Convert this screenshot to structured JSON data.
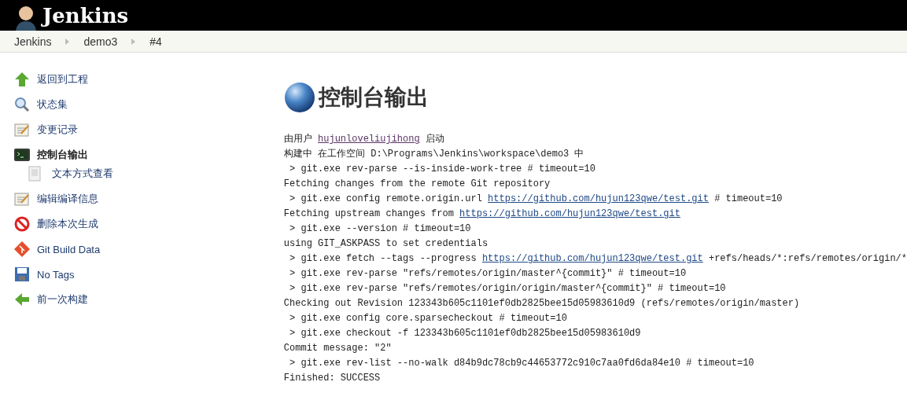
{
  "header": {
    "title": "Jenkins"
  },
  "breadcrumbs": [
    "Jenkins",
    "demo3",
    "#4"
  ],
  "sidebar": {
    "items": [
      {
        "label": "返回到工程",
        "selected": false
      },
      {
        "label": "状态集",
        "selected": false
      },
      {
        "label": "变更记录",
        "selected": false
      },
      {
        "label": "控制台输出",
        "selected": true,
        "children": [
          {
            "label": "文本方式查看",
            "selected": false
          }
        ]
      },
      {
        "label": "编辑编译信息",
        "selected": false
      },
      {
        "label": "删除本次生成",
        "selected": false
      },
      {
        "label": "Git Build Data",
        "selected": false
      },
      {
        "label": "No Tags",
        "selected": false
      },
      {
        "label": "前一次构建",
        "selected": false
      }
    ]
  },
  "page_title": "控制台输出",
  "console": [
    [
      {
        "text": "由用户 "
      },
      {
        "text": "hujunloveliujihong",
        "link": true,
        "visited": true
      },
      {
        "text": " 启动"
      }
    ],
    [
      {
        "text": "构建中 在工作空间 D:\\Programs\\Jenkins\\workspace\\demo3 中"
      }
    ],
    [
      {
        "text": " > git.exe rev-parse --is-inside-work-tree # timeout=10"
      }
    ],
    [
      {
        "text": "Fetching changes from the remote Git repository"
      }
    ],
    [
      {
        "text": " > git.exe config remote.origin.url "
      },
      {
        "text": "https://github.com/hujun123qwe/test.git",
        "link": true,
        "visited": false
      },
      {
        "text": " # timeout=10"
      }
    ],
    [
      {
        "text": "Fetching upstream changes from "
      },
      {
        "text": "https://github.com/hujun123qwe/test.git",
        "link": true,
        "visited": false
      }
    ],
    [
      {
        "text": " > git.exe --version # timeout=10"
      }
    ],
    [
      {
        "text": "using GIT_ASKPASS to set credentials"
      }
    ],
    [
      {
        "text": " > git.exe fetch --tags --progress "
      },
      {
        "text": "https://github.com/hujun123qwe/test.git",
        "link": true,
        "visited": false
      },
      {
        "text": " +refs/heads/*:refs/remotes/origin/*"
      }
    ],
    [
      {
        "text": " > git.exe rev-parse \"refs/remotes/origin/master^{commit}\" # timeout=10"
      }
    ],
    [
      {
        "text": " > git.exe rev-parse \"refs/remotes/origin/origin/master^{commit}\" # timeout=10"
      }
    ],
    [
      {
        "text": "Checking out Revision 123343b605c1101ef0db2825bee15d05983610d9 (refs/remotes/origin/master)"
      }
    ],
    [
      {
        "text": " > git.exe config core.sparsecheckout # timeout=10"
      }
    ],
    [
      {
        "text": " > git.exe checkout -f 123343b605c1101ef0db2825bee15d05983610d9"
      }
    ],
    [
      {
        "text": "Commit message: \"2\""
      }
    ],
    [
      {
        "text": " > git.exe rev-list --no-walk d84b9dc78cb9c44653772c910c7aa0fd6da84e10 # timeout=10"
      }
    ],
    [
      {
        "text": "Finished: SUCCESS"
      }
    ]
  ]
}
